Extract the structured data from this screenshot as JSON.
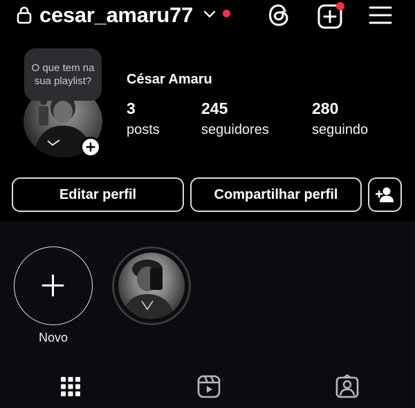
{
  "header": {
    "username": "cesar_amaru77",
    "lock_icon": "lock-icon",
    "dropdown_icon": "chevron-down-icon",
    "threads_icon": "threads-icon",
    "create_icon": "plus-square-icon",
    "menu_icon": "hamburger-menu-icon"
  },
  "colors": {
    "background": "#000000",
    "notification_dot": "#ff3040",
    "button_border": "#dcdcdc",
    "note_bubble": "#2b2d31"
  },
  "profile": {
    "note_text": "O que tem na sua playlist?",
    "display_name": "César Amaru",
    "stats": [
      {
        "value": "3",
        "label": "posts"
      },
      {
        "value": "245",
        "label": "seguidores"
      },
      {
        "value": "280",
        "label": "seguindo"
      }
    ]
  },
  "buttons": {
    "edit_profile": "Editar perfil",
    "share_profile": "Compartilhar perfil",
    "discover_people_icon": "add-person-icon"
  },
  "highlights": {
    "new_label": "Novo",
    "items": [
      {
        "image": "highlight-photo"
      }
    ]
  },
  "tabs": [
    {
      "icon": "grid-icon",
      "active": true
    },
    {
      "icon": "reels-icon",
      "active": false
    },
    {
      "icon": "tagged-icon",
      "active": false
    }
  ]
}
